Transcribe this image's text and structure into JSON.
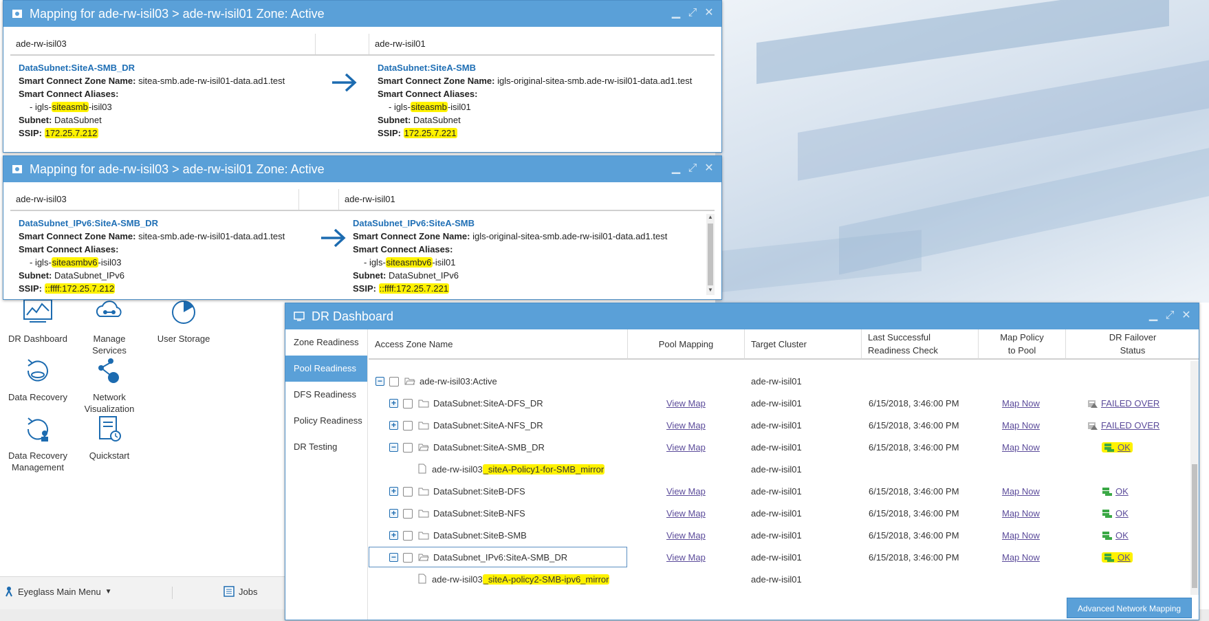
{
  "mapping_windows": [
    {
      "title": "Mapping for ade-rw-isil03 > ade-rw-isil01 Zone: Active",
      "source_header": "ade-rw-isil03",
      "target_header": "ade-rw-isil01",
      "source": {
        "name": "DataSubnet:SiteA-SMB_DR",
        "zone_label": "Smart Connect Zone Name:",
        "zone_value": "sitea-smb.ade-rw-isil01-data.ad1.test",
        "aliases_label": "Smart Connect Aliases:",
        "alias_prefix": "- igls-",
        "alias_highlight": "siteasmb",
        "alias_suffix": "-isil03",
        "subnet_label": "Subnet:",
        "subnet_value": "DataSubnet",
        "ssip_label": "SSIP:",
        "ssip_value": "172.25.7.212"
      },
      "target": {
        "name": "DataSubnet:SiteA-SMB",
        "zone_label": "Smart Connect Zone Name:",
        "zone_value": "igls-original-sitea-smb.ade-rw-isil01-data.ad1.test",
        "aliases_label": "Smart Connect Aliases:",
        "alias_prefix": "- igls-",
        "alias_highlight": "siteasmb",
        "alias_suffix": "-isil01",
        "subnet_label": "Subnet:",
        "subnet_value": "DataSubnet",
        "ssip_label": "SSIP:",
        "ssip_value": "172.25.7.221"
      }
    },
    {
      "title": "Mapping for ade-rw-isil03 > ade-rw-isil01 Zone: Active",
      "source_header": "ade-rw-isil03",
      "target_header": "ade-rw-isil01",
      "source": {
        "name": "DataSubnet_IPv6:SiteA-SMB_DR",
        "zone_label": "Smart Connect Zone Name:",
        "zone_value": "sitea-smb.ade-rw-isil01-data.ad1.test",
        "aliases_label": "Smart Connect Aliases:",
        "alias_prefix": "- igls-",
        "alias_highlight": "siteasmbv6",
        "alias_suffix": "-isil03",
        "subnet_label": "Subnet:",
        "subnet_value": "DataSubnet_IPv6",
        "ssip_label": "SSIP:",
        "ssip_value": "::ffff:172.25.7.212"
      },
      "target": {
        "name": "DataSubnet_IPv6:SiteA-SMB",
        "zone_label": "Smart Connect Zone Name:",
        "zone_value": "igls-original-sitea-smb.ade-rw-isil01-data.ad1.test",
        "aliases_label": "Smart Connect Aliases:",
        "alias_prefix": "- igls-",
        "alias_highlight": "siteasmbv6",
        "alias_suffix": "-isil01",
        "subnet_label": "Subnet:",
        "subnet_value": "DataSubnet_IPv6",
        "ssip_label": "SSIP:",
        "ssip_value": "::ffff:172.25.7.221"
      }
    }
  ],
  "desktop_icons": [
    {
      "label": "DR Dashboard",
      "icon": "chart-monitor-icon"
    },
    {
      "label": "Manage Services",
      "icon": "cloud-network-icon"
    },
    {
      "label": "User Storage",
      "icon": "pie-chart-icon"
    },
    {
      "label": "Data Recovery",
      "icon": "recovery-disk-icon"
    },
    {
      "label": "Network Visualization",
      "icon": "network-nodes-icon"
    },
    {
      "label": "Data Recovery Management",
      "icon": "recovery-user-icon"
    },
    {
      "label": "Quickstart",
      "icon": "clipboard-clock-icon"
    }
  ],
  "taskbar": {
    "main_menu": "Eyeglass Main Menu",
    "jobs": "Jobs"
  },
  "dashboard": {
    "title": "DR Dashboard",
    "nav": [
      "Zone Readiness",
      "Pool Readiness",
      "DFS Readiness",
      "Policy Readiness",
      "DR Testing"
    ],
    "active_nav": "Pool Readiness",
    "columns": {
      "zone": "Access Zone Name",
      "pool": "Pool Mapping",
      "target": "Target Cluster",
      "last_check_1": "Last Successful",
      "last_check_2": "Readiness Check",
      "map_policy_1": "Map Policy",
      "map_policy_2": "to Pool",
      "failover_1": "DR Failover",
      "failover_2": "Status"
    },
    "rows": [
      {
        "kind": "zone",
        "name": "ade-rw-isil03:Active",
        "target": "ade-rw-isil01"
      },
      {
        "kind": "pool",
        "expander": "+",
        "name": "DataSubnet:SiteA-DFS_DR",
        "pool": "View Map",
        "target": "ade-rw-isil01",
        "date": "6/15/2018, 3:46:00 PM",
        "map": "Map Now",
        "status": "FAILED OVER",
        "status_type": "failed"
      },
      {
        "kind": "pool",
        "expander": "+",
        "name": "DataSubnet:SiteA-NFS_DR",
        "pool": "View Map",
        "target": "ade-rw-isil01",
        "date": "6/15/2018, 3:46:00 PM",
        "map": "Map Now",
        "status": "FAILED OVER",
        "status_type": "failed"
      },
      {
        "kind": "pool",
        "expander": "−",
        "name": "DataSubnet:SiteA-SMB_DR",
        "pool": "View Map",
        "target": "ade-rw-isil01",
        "date": "6/15/2018, 3:46:00 PM",
        "map": "Map Now",
        "status": "OK",
        "status_type": "ok-hl"
      },
      {
        "kind": "policy",
        "prefix": "ade-rw-isil03",
        "highlight": "_siteA-Policy1-for-SMB_mirror",
        "target": "ade-rw-isil01"
      },
      {
        "kind": "pool",
        "expander": "+",
        "name": "DataSubnet:SiteB-DFS",
        "pool": "View Map",
        "target": "ade-rw-isil01",
        "date": "6/15/2018, 3:46:00 PM",
        "map": "Map Now",
        "status": "OK",
        "status_type": "ok"
      },
      {
        "kind": "pool",
        "expander": "+",
        "name": "DataSubnet:SiteB-NFS",
        "pool": "View Map",
        "target": "ade-rw-isil01",
        "date": "6/15/2018, 3:46:00 PM",
        "map": "Map Now",
        "status": "OK",
        "status_type": "ok"
      },
      {
        "kind": "pool",
        "expander": "+",
        "name": "DataSubnet:SiteB-SMB",
        "pool": "View Map",
        "target": "ade-rw-isil01",
        "date": "6/15/2018, 3:46:00 PM",
        "map": "Map Now",
        "status": "OK",
        "status_type": "ok"
      },
      {
        "kind": "pool",
        "expander": "−",
        "name": "DataSubnet_IPv6:SiteA-SMB_DR",
        "pool": "View Map",
        "target": "ade-rw-isil01",
        "date": "6/15/2018, 3:46:00 PM",
        "map": "Map Now",
        "status": "OK",
        "status_type": "ok-hl",
        "selected": true
      },
      {
        "kind": "policy",
        "prefix": "ade-rw-isil03",
        "highlight": "_siteA-policy2-SMB-ipv6_mirror",
        "target": "ade-rw-isil01"
      }
    ],
    "advanced_button": "Advanced Network Mapping"
  },
  "colors": {
    "titlebar": "#5aa0d8",
    "link_blue": "#1f6fb5",
    "visited_link": "#5b4b9a",
    "highlight": "#fff200",
    "ok_green": "#3aa845"
  }
}
